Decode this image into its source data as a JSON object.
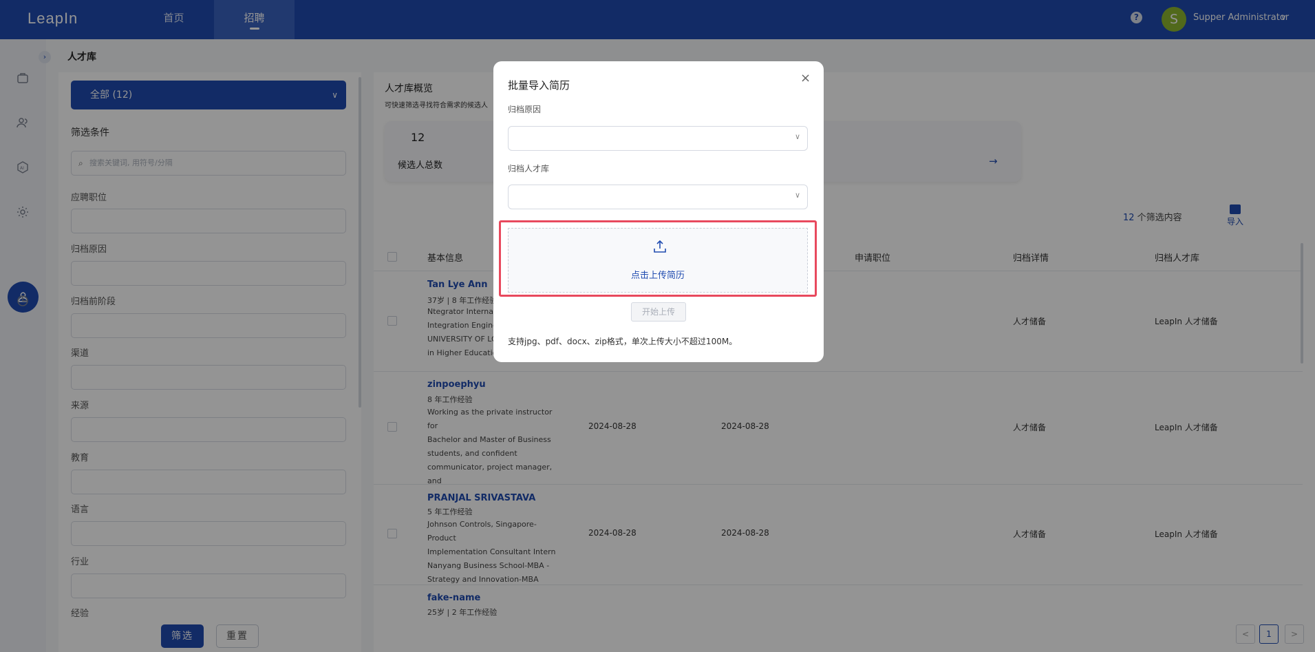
{
  "app": {
    "logo": "LeapIn"
  },
  "topnav": {
    "tabs": [
      {
        "label": "首页"
      },
      {
        "label": "招聘"
      }
    ],
    "help": "?",
    "user": {
      "initial": "S",
      "name": "Supper Administrator",
      "chevron": "∨"
    }
  },
  "sidebar": {
    "icons": [
      "briefcase-icon",
      "users-icon",
      "ai-icon",
      "settings-icon",
      "talent-pool-icon",
      "chart-icon"
    ],
    "expand": "›"
  },
  "breadcrumb": "人才库",
  "filters": {
    "all_select": "全部 (12)",
    "title": "筛选条件",
    "search_placeholder": "搜索关键词, 用符号/分隔",
    "fields": [
      "应聘职位",
      "归档原因",
      "归档前阶段",
      "渠道",
      "来源",
      "教育",
      "语言",
      "行业",
      "经验"
    ],
    "filter_btn": "筛选",
    "reset_btn": "重置"
  },
  "overview": {
    "title": "人才库概览",
    "subtitle": "可快速筛选寻找符合需求的候选人",
    "total": "12",
    "total_label": "候选人总数",
    "arrow": "→"
  },
  "list": {
    "count": "12",
    "count_suffix": " 个筛选内容",
    "import_label": "导入",
    "columns": {
      "basic": "基本信息",
      "position": "申请职位",
      "detail": "归档详情",
      "pool": "归档人才库"
    },
    "rows": [
      {
        "name": "Tan Lye Ann",
        "meta": "37岁 | 8 年工作经验",
        "desc_lines": [
          "Ntegrator Internat",
          "Integration Engine",
          "UNIVERSITY OF LO",
          "in Higher Educatio"
        ],
        "date1": "",
        "date2": "",
        "detail": "人才储备",
        "pool": "LeapIn 人才储备"
      },
      {
        "name": "zinpoephyu",
        "meta": "8 年工作经验",
        "desc_lines": [
          "Working as the private instructor for",
          "Bachelor and Master of Business",
          "students, and confident",
          "communicator, project manager, and",
          ".."
        ],
        "date1": "2024-08-28",
        "date2": "2024-08-28",
        "detail": "人才储备",
        "pool": "LeapIn 人才储备"
      },
      {
        "name": "PRANJAL SRIVASTAVA",
        "meta": "5 年工作经验",
        "desc_lines": [
          "Johnson Controls, Singapore-Product",
          "Implementation Consultant Intern",
          "Nanyang Business School-MBA -",
          "Strategy and Innovation-MBA"
        ],
        "date1": "2024-08-28",
        "date2": "2024-08-28",
        "detail": "人才储备",
        "pool": "LeapIn 人才储备"
      },
      {
        "name": "fake-name",
        "meta": "25岁 | 2 年工作经验",
        "desc_lines": [],
        "date1": "",
        "date2": "",
        "detail": "",
        "pool": ""
      }
    ],
    "pagination": {
      "prev": "<",
      "page": "1",
      "next": ">"
    }
  },
  "modal": {
    "title": "批量导入简历",
    "close": "×",
    "label_reason": "归档原因",
    "label_pool": "归档人才库",
    "upload_text": "点击上传简历",
    "start_btn": "开始上传",
    "hint": "支持jpg、pdf、docx、zip格式，单次上传大小不超过100M。"
  },
  "colors": {
    "primary": "#1f4bb0",
    "highlight": "#e8495d",
    "avatar": "#8cb530"
  }
}
